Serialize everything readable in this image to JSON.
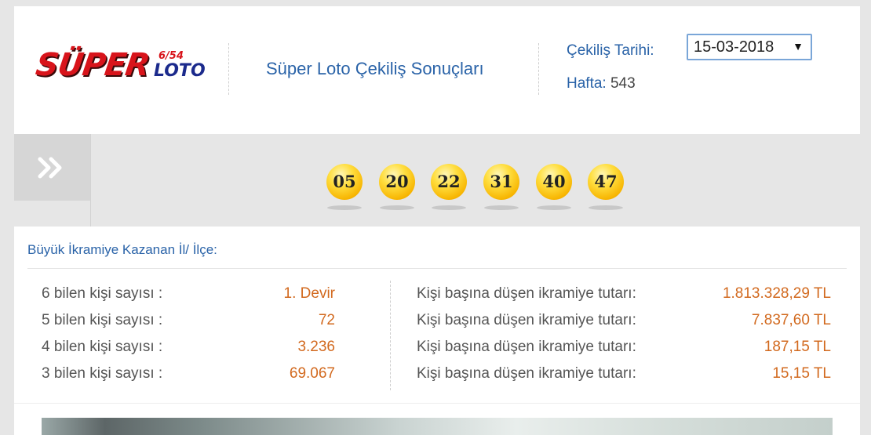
{
  "header": {
    "logo_super": "SÜPER",
    "logo_654": "6/54",
    "logo_loto": "LOTO",
    "title": "Süper Loto Çekiliş Sonuçları",
    "date_label": "Çekiliş Tarihi:",
    "date_value": "15-03-2018",
    "week_label": "Hafta:",
    "week_value": "543"
  },
  "numbers": [
    "05",
    "20",
    "22",
    "31",
    "40",
    "47"
  ],
  "winner_place_label": "Büyük İkramiye Kazanan İl/ İlçe:",
  "results": [
    {
      "label": "6 bilen kişi sayısı :",
      "count": "1. Devir",
      "prize_label": "Kişi başına düşen ikramiye tutarı:",
      "prize": "1.813.328,29 TL"
    },
    {
      "label": "5 bilen kişi sayısı :",
      "count": "72",
      "prize_label": "Kişi başına düşen ikramiye tutarı:",
      "prize": "7.837,60 TL"
    },
    {
      "label": "4 bilen kişi sayısı :",
      "count": "3.236",
      "prize_label": "Kişi başına düşen ikramiye tutarı:",
      "prize": "187,15 TL"
    },
    {
      "label": "3 bilen kişi sayısı :",
      "count": "69.067",
      "prize_label": "Kişi başına düşen ikramiye tutarı:",
      "prize": "15,15 TL"
    }
  ],
  "colors": {
    "accent": "#2a63a8",
    "value": "#d2691e",
    "ball": "#ffd21f",
    "logo_red": "#d8141b",
    "logo_blue": "#1b2a8c"
  }
}
